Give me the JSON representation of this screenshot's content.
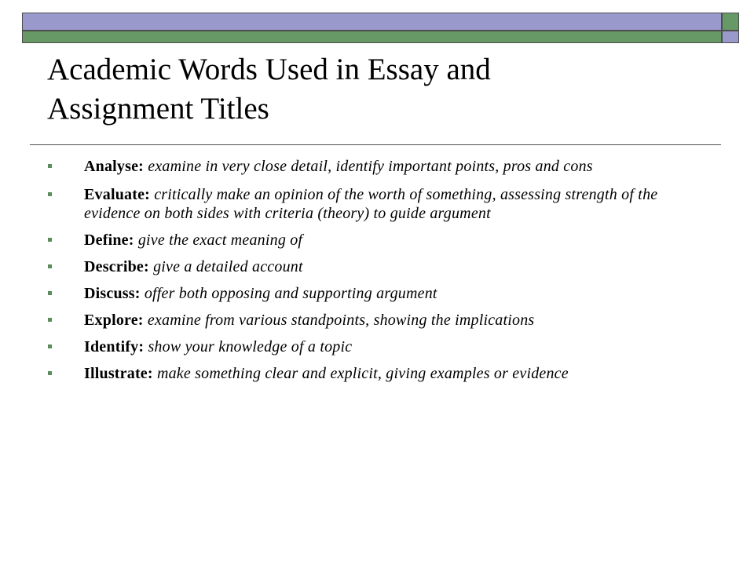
{
  "colors": {
    "lavender": "#9999cc",
    "green": "#669966",
    "bullet": "#5b8c5a",
    "divider": "#4d4d4d"
  },
  "slide": {
    "title_line1": "Academic Words Used in Essay and",
    "title_line2": "Assignment Titles",
    "bullet_icon": "square-bullet-icon",
    "bullets": [
      {
        "term": "Analyse:",
        "definition": "examine in very close detail, identify important points, pros and cons"
      },
      {
        "term": "Evaluate:",
        "definition": "critically make an opinion of the worth of something, assessing strength of the evidence on both sides with criteria (theory) to guide argument"
      },
      {
        "term": "Define:",
        "definition": "give the exact meaning of"
      },
      {
        "term": "Describe:",
        "definition": "give a detailed account"
      },
      {
        "term": "Discuss:",
        "definition": "offer both opposing and supporting argument"
      },
      {
        "term": "Explore:",
        "definition": "examine from various standpoints, showing the implications"
      },
      {
        "term": "Identify:",
        "definition": "show your knowledge of a topic"
      },
      {
        "term": "Illustrate:",
        "definition": "make something clear and explicit, giving examples or evidence"
      }
    ]
  }
}
